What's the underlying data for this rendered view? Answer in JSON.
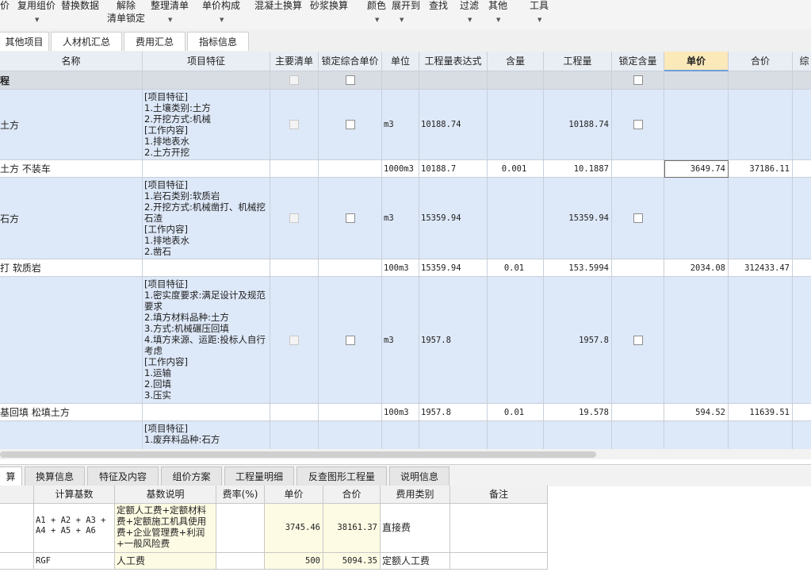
{
  "toolbar": {
    "items": [
      "价",
      "复用组价",
      "替换数据",
      "解除",
      "整理清单",
      "单价构成",
      "混凝土换算",
      "砂浆换算",
      "颜色",
      "展开到",
      "查找",
      "过滤",
      "其他",
      "工具"
    ],
    "unlock_line2": "清单锁定"
  },
  "tabs": [
    "其他项目",
    "人材机汇总",
    "费用汇总",
    "指标信息"
  ],
  "grid": {
    "headers": [
      "名称",
      "项目特征",
      "主要清单",
      "锁定综合单价",
      "单位",
      "工程量表达式",
      "含量",
      "工程量",
      "锁定含量",
      "单价",
      "合价",
      "综"
    ],
    "rows": [
      {
        "name": "程",
        "feature": "",
        "unit": "",
        "expr": "",
        "content": "",
        "qty": "",
        "price": "",
        "total": ""
      },
      {
        "name": "土方",
        "feature": "[项目特征]\n1.土壤类别:土方\n2.开挖方式:机械\n[工作内容]\n1.排地表水\n2.土方开挖",
        "unit": "m3",
        "expr": "10188.74",
        "content": "",
        "qty": "10188.74",
        "price": "",
        "total": ""
      },
      {
        "name": "土方 不装车",
        "feature": "",
        "unit": "1000m3",
        "expr": "10188.7",
        "content": "0.001",
        "qty": "10.1887",
        "price": "3649.74",
        "total": "37186.11"
      },
      {
        "name": "石方",
        "feature": "[项目特征]\n1.岩石类别:软质岩\n2.开挖方式:机械凿打、机械挖石渣\n[工作内容]\n1.排地表水\n2.凿石",
        "unit": "m3",
        "expr": "15359.94",
        "content": "",
        "qty": "15359.94",
        "price": "",
        "total": ""
      },
      {
        "name": "打 软质岩",
        "feature": "",
        "unit": "100m3",
        "expr": "15359.94",
        "content": "0.01",
        "qty": "153.5994",
        "price": "2034.08",
        "total": "312433.47"
      },
      {
        "name": "",
        "feature": "[项目特征]\n1.密实度要求:满足设计及规范要求\n2.填方材料品种:土方\n3.方式:机械碾压回填\n4.填方来源、运距:投标人自行考虑\n[工作内容]\n1.运输\n2.回填\n3.压实",
        "unit": "m3",
        "expr": "1957.8",
        "content": "",
        "qty": "1957.8",
        "price": "",
        "total": ""
      },
      {
        "name": "基回填 松填土方",
        "feature": "",
        "unit": "100m3",
        "expr": "1957.8",
        "content": "0.01",
        "qty": "19.578",
        "price": "594.52",
        "total": "11639.51"
      },
      {
        "name": "",
        "feature": "[项目特征]\n1.废弃料品种:石方",
        "unit": "",
        "expr": "",
        "content": "",
        "qty": "",
        "price": "",
        "total": ""
      }
    ]
  },
  "bottom_tabs": [
    "算",
    "换算信息",
    "特征及内容",
    "组价方案",
    "工程量明细",
    "反查图形工程量",
    "说明信息"
  ],
  "bottom_grid": {
    "headers": [
      "",
      "计算基数",
      "基数说明",
      "费率(%)",
      "单价",
      "合价",
      "费用类别",
      "备注"
    ],
    "rows": [
      {
        "base": "A1 + A2 + A3 +\nA4 + A5 + A6",
        "desc": "定额人工费+定额材料费+定额施工机具使用费+企业管理费+利润+一般风险费",
        "rate": "",
        "price": "3745.46",
        "total": "38161.37",
        "category": "直接费",
        "note": ""
      },
      {
        "base": "RGF",
        "desc": "人工费",
        "rate": "",
        "price": "500",
        "total": "5094.35",
        "category": "定额人工费",
        "note": ""
      }
    ]
  },
  "colors": {
    "item_row": "#dde8f8",
    "accent": "#6f9fd8",
    "active_header": "#fbe9b9"
  }
}
